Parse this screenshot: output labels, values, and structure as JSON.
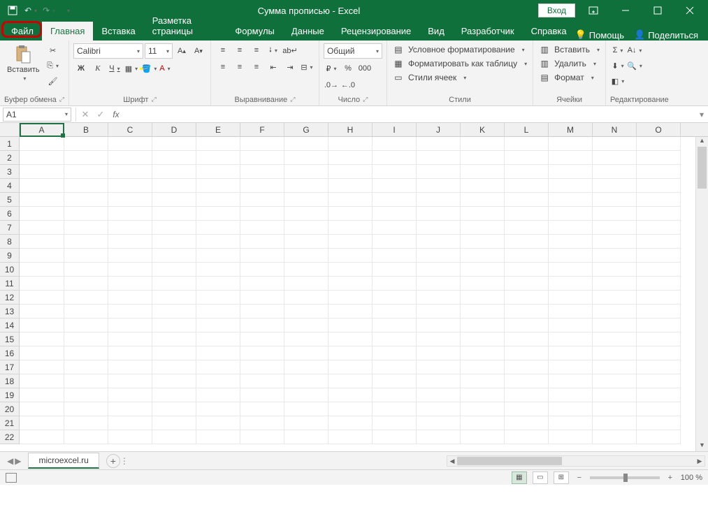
{
  "title": "Сумма прописью  -  Excel",
  "login": "Вход",
  "tabs": {
    "file": "Файл",
    "home": "Главная",
    "insert": "Вставка",
    "layout": "Разметка страницы",
    "formulas": "Формулы",
    "data": "Данные",
    "review": "Рецензирование",
    "view": "Вид",
    "developer": "Разработчик",
    "help": "Справка",
    "tell": "Помощь",
    "share": "Поделиться"
  },
  "ribbon": {
    "clipboard": {
      "label": "Буфер обмена",
      "paste": "Вставить"
    },
    "font": {
      "label": "Шрифт",
      "name": "Calibri",
      "size": "11",
      "bold": "Ж",
      "italic": "К",
      "underline": "Ч"
    },
    "align": {
      "label": "Выравнивание"
    },
    "number": {
      "label": "Число",
      "format": "Общий"
    },
    "styles": {
      "label": "Стили",
      "cond": "Условное форматирование",
      "table": "Форматировать как таблицу",
      "cell": "Стили ячеек"
    },
    "cells": {
      "label": "Ячейки",
      "insert": "Вставить",
      "delete": "Удалить",
      "format": "Формат"
    },
    "editing": {
      "label": "Редактирование"
    }
  },
  "namebox": "A1",
  "columns": [
    "A",
    "B",
    "C",
    "D",
    "E",
    "F",
    "G",
    "H",
    "I",
    "J",
    "K",
    "L",
    "M",
    "N",
    "O"
  ],
  "rows": [
    1,
    2,
    3,
    4,
    5,
    6,
    7,
    8,
    9,
    10,
    11,
    12,
    13,
    14,
    15,
    16,
    17,
    18,
    19,
    20,
    21,
    22
  ],
  "sheet": "microexcel.ru",
  "zoom": "100 %"
}
